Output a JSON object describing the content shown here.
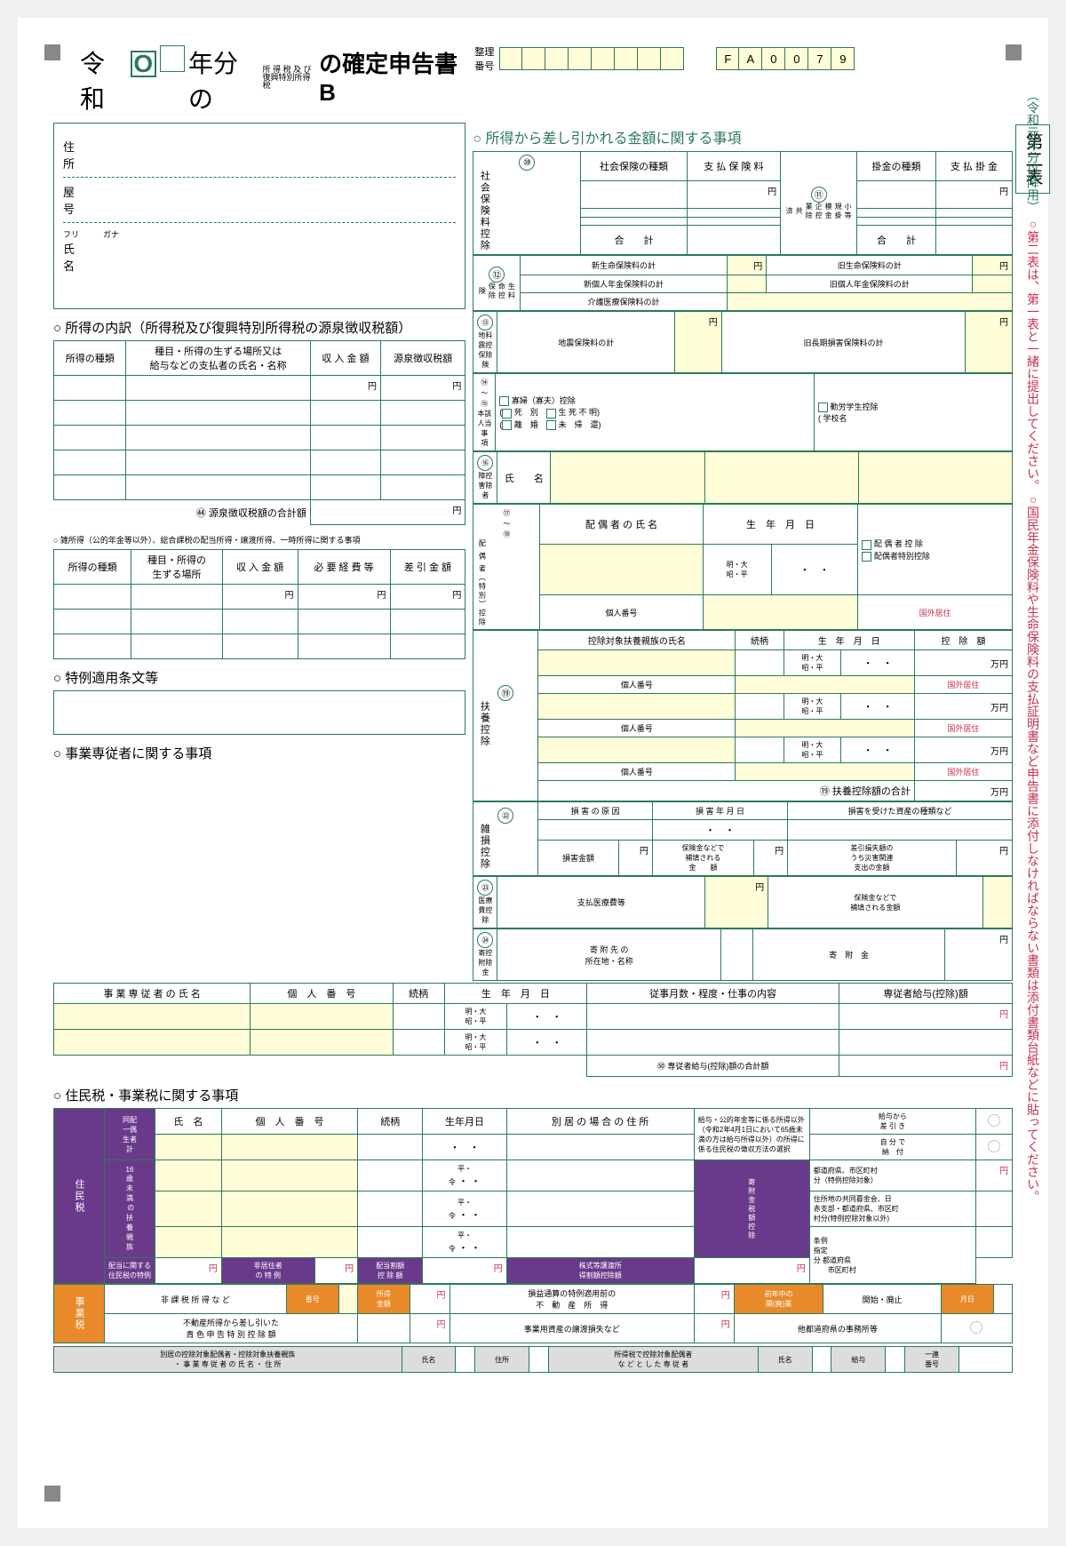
{
  "formId": "FA0079",
  "title": {
    "era": "令和",
    "eraMark": "O",
    "year": "年分の",
    "tax1": "所 得 税 及 び",
    "tax2": "復興特別所得税",
    "suffix": "の確定申告書B"
  },
  "seiri": "整理\n番号",
  "addr": {
    "l1": "住　　所",
    "l2": "屋　　号",
    "l3f": "フリ　　　ガナ",
    "l3": "氏　　名"
  },
  "sec1": {
    "h": "○ 所得の内訳（所得税及び復興特別所得税の源泉徴収税額）",
    "c1": "所得の種類",
    "c2": "種目・所得の生ずる場所又は\n給与などの支払者の氏名・名称",
    "c3": "収 入 金 額",
    "c4": "源泉徴収税額",
    "total": "㊹ 源泉徴収税額の合計額"
  },
  "sec2": {
    "h": "○ 雑所得（公的年金等以外）、総合課税の配当所得・譲渡所得、一時所得に関する事項",
    "c1": "所得の種類",
    "c2": "種目・所得の\n生ずる場所",
    "c3": "収 入 金 額",
    "c4": "必 要 経 費 等",
    "c5": "差 引 金 額"
  },
  "sec3": "○ 特例適用条文等",
  "sec4": {
    "h": "○ 事業専従者に関する事項",
    "c1": "事 業 専 従 者 の 氏 名",
    "c2": "個　人　番　号",
    "c3": "続柄",
    "c4": "生　年　月　日",
    "c5": "従事月数・程度・仕事の内容",
    "c6": "専従者給与(控除)額",
    "era": "明・大\n昭・平",
    "total": "㊿ 専従者給与(控除)額の合計額"
  },
  "sec5": "○ 住民税・事業税に関する事項",
  "rhead": "○ 所得から差し引かれる金額に関する事項",
  "r10": {
    "n": "⑩",
    "v": "社会保険料控除",
    "c1": "社会保険の種類",
    "c2": "支 払 保 険 料",
    "t": "合　　計"
  },
  "r11": {
    "n": "⑪",
    "v": "小等\n規掛\n模金\n企控\n業除\n共\n済",
    "c1": "掛金の種類",
    "c2": "支 払 掛 金",
    "t": "合　　計"
  },
  "r12": {
    "n": "⑫",
    "v": "生料\n命控\n保除\n険",
    "a": "新生命保険料の計",
    "b": "新個人年金保険料の計",
    "c": "介護医療保険料の計",
    "d": "旧生命保険料の計",
    "e": "旧個人年金保険料の計"
  },
  "r13": {
    "n": "⑬",
    "v": "地料\n震控\n保除\n険",
    "a": "地震保険料の計",
    "b": "旧長期損害保険料の計"
  },
  "r14": {
    "n": "⑭\n〜\n⑮",
    "v": "本該\n人当\n事\n項",
    "a": "寡婦（寡夫）控除",
    "b": "死　別",
    "c": "生 死 不 明",
    "d": "離　婚",
    "e": "未　帰　還",
    "f": "勤労学生控除",
    "g": "学校名"
  },
  "r16": {
    "n": "⑯",
    "v": "障控\n害除\n者",
    "a": "氏　　名"
  },
  "r17": {
    "n": "⑰\n〜\n⑱",
    "v": "配\n偶\n者（特別）控除",
    "a": "配 偶 者 の 氏 名",
    "b": "生　年　月　日",
    "c": "配 偶 者 控 除",
    "d": "配偶者特別控除",
    "e": "個人番号",
    "f": "国外居住",
    "era": "明・大\n昭・平"
  },
  "r19": {
    "n": "⑲",
    "v": "扶養控除",
    "a": "控除対象扶養親族の氏名",
    "b": "続柄",
    "c": "生　年　月　日",
    "d": "控　除　額",
    "e": "個人番号",
    "f": "国外居住",
    "t": "⑲ 扶養控除額の合計",
    "era": "明・大\n昭・平"
  },
  "r22": {
    "n": "㉒",
    "v": "雑損控除",
    "a": "損 害 の 原 因",
    "b": "損 害 年 月 日",
    "c": "損害を受けた資産の種類など",
    "d": "損害金額",
    "e": "保険金などで\n補填される\n金　　額",
    "f": "差引損失額の\nうち災害関連\n支出の金額"
  },
  "r23": {
    "n": "㉓",
    "v": "医療\n費控\n除",
    "a": "支払医療費等",
    "b": "保険金などで\n補填される金額"
  },
  "r24": {
    "n": "㉔",
    "v": "寄控\n附除\n金",
    "a": "寄 附 先 の\n所在地・名称",
    "b": "寄　附　金"
  },
  "resTax": {
    "v1": "住民税",
    "v2": "事業税",
    "a": "同配\n一偶\n生者\n計",
    "b": "16\n歳\n未\n満\n の\n扶\n養\n親\n族",
    "c1": "氏　名",
    "c2": "個　人　番　号",
    "c3": "続柄",
    "c4": "生年月日",
    "c5": "別 居 の 場 合 の 住 所",
    "opt1": "給与・公的年金等に係る所得以外（令和2年4月1日において65歳未満の方は給与所得以外）の所得に係る住民税の徴収方法の選択",
    "opt1a": "給与から\n差 引 き",
    "opt1b": "自 分 で\n納　付",
    "era": "平・\n令",
    "furi": "寄附金税額控除",
    "f1": "都道府県、市区町村\n分（特例控除対象）",
    "f2": "住所地の共同募金会、日\n赤支部・都道府県、市区町\n村分(特例控除対象以外)",
    "f3": "条例\n指定\n分",
    "f3a": "都道府県",
    "f3b": "市区町村",
    "g1": "配当に関する\n住民税の特例",
    "g2": "非居住者\nの 特 例",
    "g3": "配当割額\n控 除 額",
    "g4": "株式等譲渡所\n得割額控除額"
  },
  "bizTax": {
    "a": "非 課 税 所 得 な ど",
    "b": "番号",
    "c": "所得\n金額",
    "d": "損益通算の特例適用前の\n不　動　産　所　得",
    "e": "前年中の\n開(廃)業",
    "f": "開始・廃止",
    "g": "月日",
    "h": "不動産所得から差し引いた\n青 色 申 告 特 別 控 除 額",
    "i": "事業用資産の譲渡損失など",
    "j": "他都道府県の事務所等"
  },
  "bottom": {
    "a": "別居の控除対象配偶者・控除対象扶養親族\n・ 事 業 専 従 者 の 氏 名 ・ 住 所",
    "b": "氏名",
    "c": "住所",
    "d": "所得税で控除対象配偶者\nな ど と し た 専 従 者",
    "e": "氏名",
    "f": "給与",
    "g": "一連\n番号"
  },
  "sideTab": "第二表",
  "sideNote": {
    "g1": "（令和元年分以降用）",
    "r1": "○第二表は、第一表と一緒に提出してください。○国民年金保険料や生命保険料の支払証明書など申告書に添付しなければならない書類は添付書類台紙などに貼ってください。"
  },
  "yen": "円",
  "manYen": "万円"
}
